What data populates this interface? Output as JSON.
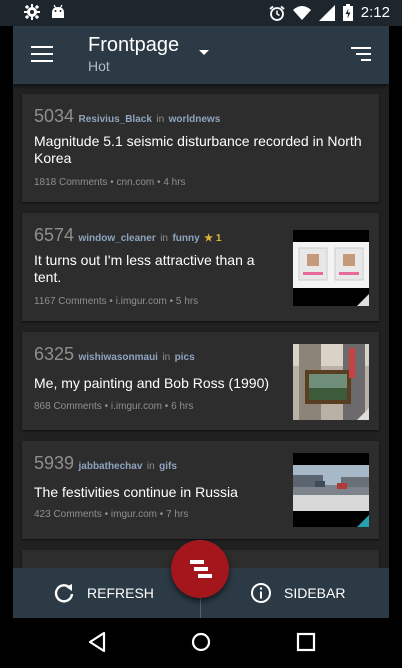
{
  "status_bar": {
    "time": "2:12",
    "left_icons": [
      "settings-icon",
      "android-icon"
    ],
    "right_icons": [
      "alarm-icon",
      "wifi-icon",
      "signal-icon",
      "battery-icon"
    ]
  },
  "toolbar": {
    "title": "Frontpage",
    "subtitle": "Hot",
    "menu_icon": "menu-icon",
    "sort_icon": "sort-icon"
  },
  "posts": [
    {
      "score": "5034",
      "author": "Resivius_Black",
      "in": "in",
      "subreddit": "worldnews",
      "gold": "",
      "title": "Magnitude 5.1 seismic disturbance recorded in North Korea",
      "comments": "1818 Comments",
      "domain": "cnn.com",
      "age": "4 hrs",
      "has_thumbnail": false
    },
    {
      "score": "6574",
      "author": "window_cleaner",
      "in": "in",
      "subreddit": "funny",
      "gold": "★ 1",
      "title": "It turns out I'm less attractive than a tent.",
      "comments": "1167 Comments",
      "domain": "i.imgur.com",
      "age": "5 hrs",
      "has_thumbnail": true
    },
    {
      "score": "6325",
      "author": "wishiwasonmaui",
      "in": "in",
      "subreddit": "pics",
      "gold": "",
      "title": "Me, my painting and Bob Ross (1990)",
      "comments": "868 Comments",
      "domain": "i.imgur.com",
      "age": "6 hrs",
      "has_thumbnail": true
    },
    {
      "score": "5939",
      "author": "jabbathechav",
      "in": "in",
      "subreddit": "gifs",
      "gold": "",
      "title": "The festivities continue in Russia",
      "comments": "423 Comments",
      "domain": "imgur.com",
      "age": "7 hrs",
      "has_thumbnail": true
    }
  ],
  "meta_separator": "•",
  "bottom_bar": {
    "refresh_label": "REFRESH",
    "sidebar_label": "SIDEBAR"
  },
  "colors": {
    "toolbar": "#2b3a44",
    "card": "#2d2d2d",
    "fab": "#a3171c",
    "link": "#8fa4bf",
    "gold": "#e0b33a"
  }
}
